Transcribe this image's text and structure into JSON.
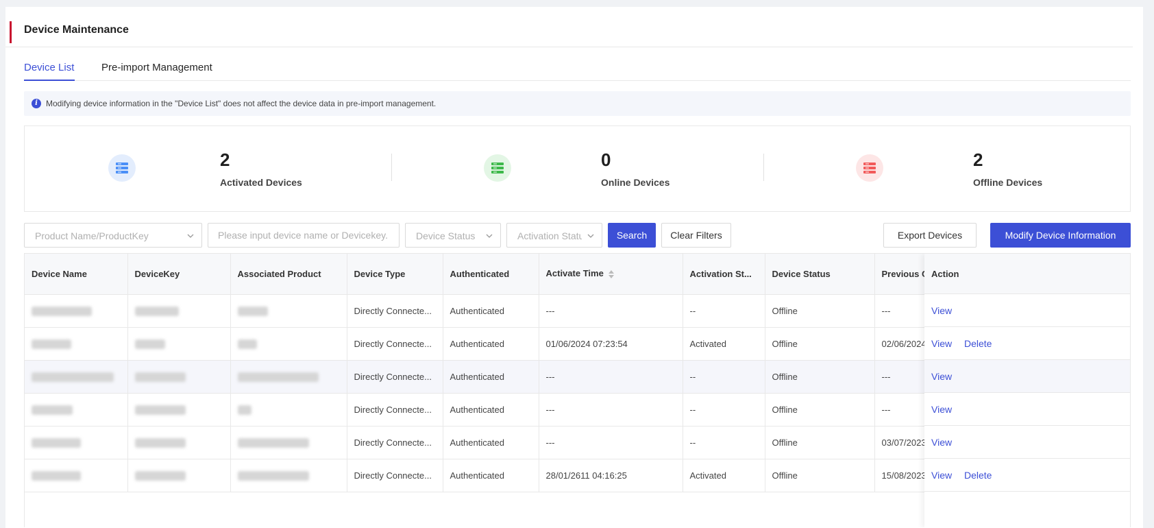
{
  "page": {
    "title": "Device Maintenance",
    "accent": "#c8102e",
    "primary": "#3c4fd6"
  },
  "tabs": [
    {
      "label": "Device List",
      "active": true
    },
    {
      "label": "Pre-import Management",
      "active": false
    }
  ],
  "notice": {
    "icon": "info-icon",
    "text": "Modifying device information in the \"Device List\" does not affect the device data in pre-import management."
  },
  "stats": [
    {
      "value": "2",
      "label": "Activated Devices",
      "icon": "server-icon",
      "color": "#4a8ff7"
    },
    {
      "value": "0",
      "label": "Online Devices",
      "icon": "server-icon",
      "color": "#3cb84a"
    },
    {
      "value": "2",
      "label": "Offline Devices",
      "icon": "server-icon",
      "color": "#f25a5a"
    }
  ],
  "filters": {
    "product": "Product Name/ProductKey",
    "device_search": "Please input device name or Devicekey.",
    "device_status": "Device Status",
    "activation_status": "Activation Status",
    "search_label": "Search",
    "clear_label": "Clear Filters",
    "export_label": "Export Devices",
    "modify_label": "Modify Device Information"
  },
  "table": {
    "columns": [
      "Device Name",
      "DeviceKey",
      "Associated Product",
      "Device Type",
      "Authenticated",
      "Activate Time",
      "Activation St...",
      "Device Status",
      "Previous C",
      "Action"
    ],
    "rows": [
      {
        "type": "Directly Connecte...",
        "auth": "Authenticated",
        "activate_time": "---",
        "activation": "--",
        "status": "Offline",
        "previous": "---",
        "actions": [
          "View"
        ]
      },
      {
        "type": "Directly Connecte...",
        "auth": "Authenticated",
        "activate_time": "01/06/2024 07:23:54",
        "activation": "Activated",
        "status": "Offline",
        "previous": "02/06/2024",
        "actions": [
          "View",
          "Delete"
        ]
      },
      {
        "type": "Directly Connecte...",
        "auth": "Authenticated",
        "activate_time": "---",
        "activation": "--",
        "status": "Offline",
        "previous": "---",
        "actions": [
          "View"
        ]
      },
      {
        "type": "Directly Connecte...",
        "auth": "Authenticated",
        "activate_time": "---",
        "activation": "--",
        "status": "Offline",
        "previous": "---",
        "actions": [
          "View"
        ]
      },
      {
        "type": "Directly Connecte...",
        "auth": "Authenticated",
        "activate_time": "---",
        "activation": "--",
        "status": "Offline",
        "previous": "03/07/2023",
        "actions": [
          "View"
        ]
      },
      {
        "type": "Directly Connecte...",
        "auth": "Authenticated",
        "activate_time": "28/01/2611 04:16:25",
        "activation": "Activated",
        "status": "Offline",
        "previous": "15/08/2023",
        "actions": [
          "View",
          "Delete"
        ]
      }
    ]
  }
}
